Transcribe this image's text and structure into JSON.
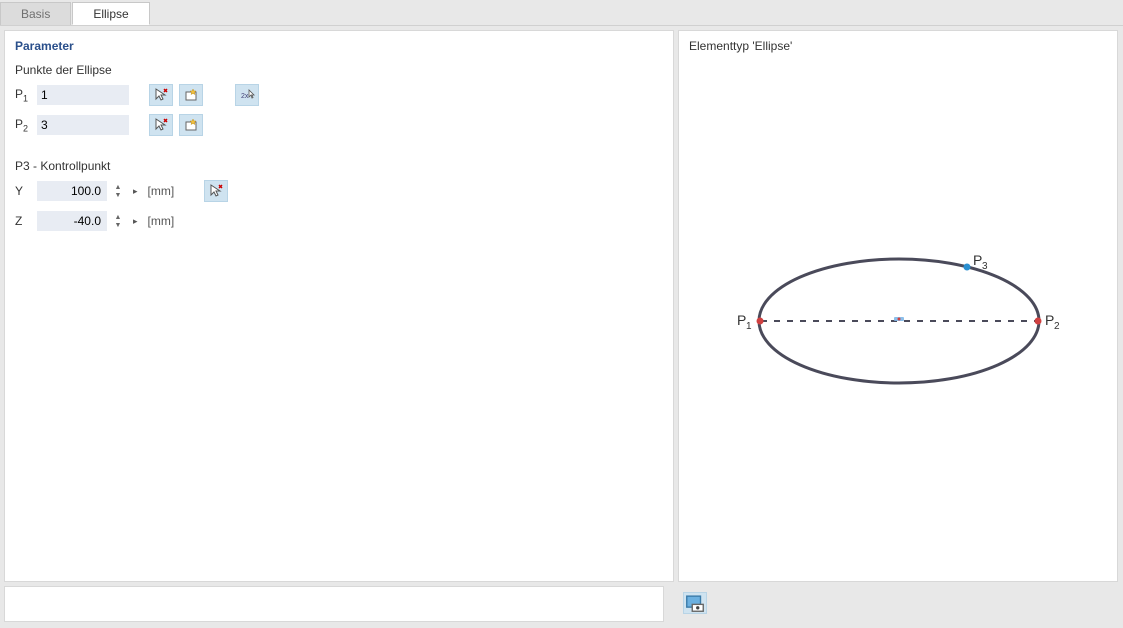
{
  "tabs": {
    "basis": "Basis",
    "ellipse": "Ellipse"
  },
  "left": {
    "title": "Parameter",
    "points_title": "Punkte der Ellipse",
    "p1_label": "P",
    "p1_sub": "1",
    "p1_value": "1",
    "p2_label": "P",
    "p2_sub": "2",
    "p2_value": "3",
    "p3_title": "P3 - Kontrollpunkt",
    "y_label": "Y",
    "y_value": "100.0",
    "z_label": "Z",
    "z_value": "-40.0",
    "unit": "[mm]"
  },
  "right": {
    "title": "Elementtyp 'Ellipse'",
    "p1": "P",
    "p1s": "1",
    "p2": "P",
    "p2s": "2",
    "p3": "P",
    "p3s": "3"
  }
}
